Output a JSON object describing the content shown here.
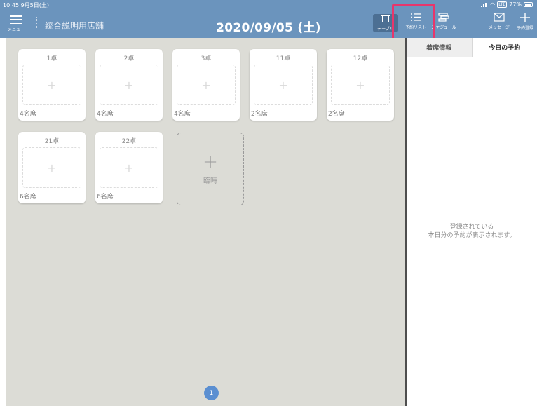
{
  "status_bar": {
    "time": "10:45  9月5日(土)",
    "battery_percent": "77%",
    "battery_badge": "LTE"
  },
  "header": {
    "menu_label": "メニュー",
    "store_name": "統合説明用店舗",
    "date_title": "2020/09/05 (土)",
    "nav": {
      "table_label": "テーブル",
      "list_label": "予約リスト",
      "schedule_label": "スケジュール",
      "message_label": "メッセージ",
      "add_label": "予約登録"
    },
    "accent_color": "#6b94bd",
    "highlight_color": "#e8366b"
  },
  "tables": [
    {
      "name": "1卓",
      "seats": "4名席"
    },
    {
      "name": "2卓",
      "seats": "4名席"
    },
    {
      "name": "3卓",
      "seats": "4名席"
    },
    {
      "name": "11卓",
      "seats": "2名席"
    },
    {
      "name": "12卓",
      "seats": "2名席"
    },
    {
      "name": "21卓",
      "seats": "6名席"
    },
    {
      "name": "22卓",
      "seats": "6名席"
    }
  ],
  "temp_table": {
    "plus": "+",
    "label": "臨時"
  },
  "slot_plus": "+",
  "pagination": {
    "current": "1"
  },
  "right_panel": {
    "tabs": [
      {
        "label": "着席情報"
      },
      {
        "label": "今日の予約"
      }
    ],
    "active_tab": "今日の予約",
    "empty_line1": "登録されている",
    "empty_line2": "本日分の予約が表示されます。"
  }
}
